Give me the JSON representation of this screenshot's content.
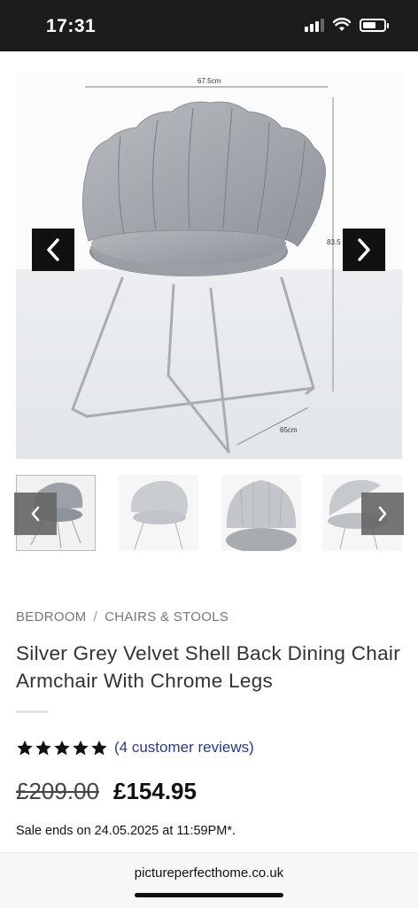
{
  "status": {
    "time": "17:31"
  },
  "gallery": {
    "dim_width": "67.5cm",
    "dim_height": "83.5",
    "dim_depth": "65cm",
    "prev_icon": "chevron-left-icon",
    "next_icon": "chevron-right-icon"
  },
  "breadcrumb": {
    "item1": "BEDROOM",
    "separator": "/",
    "item2": "CHAIRS & STOOLS"
  },
  "product": {
    "title": "Silver Grey Velvet Shell Back Dining Chair Armchair With Chrome Legs",
    "rating": 5,
    "reviews_label": "(4 customer reviews)",
    "old_price": "£209.00",
    "price": "£154.95",
    "sale_text": "Sale ends on 24.05.2025 at 11:59PM*."
  },
  "browser": {
    "url": "pictureperfecthome.co.uk"
  },
  "colors": {
    "star": "#111111",
    "link": "#2a3c7a",
    "arrow_dark": "#111111",
    "arrow_grey": "#666666"
  }
}
